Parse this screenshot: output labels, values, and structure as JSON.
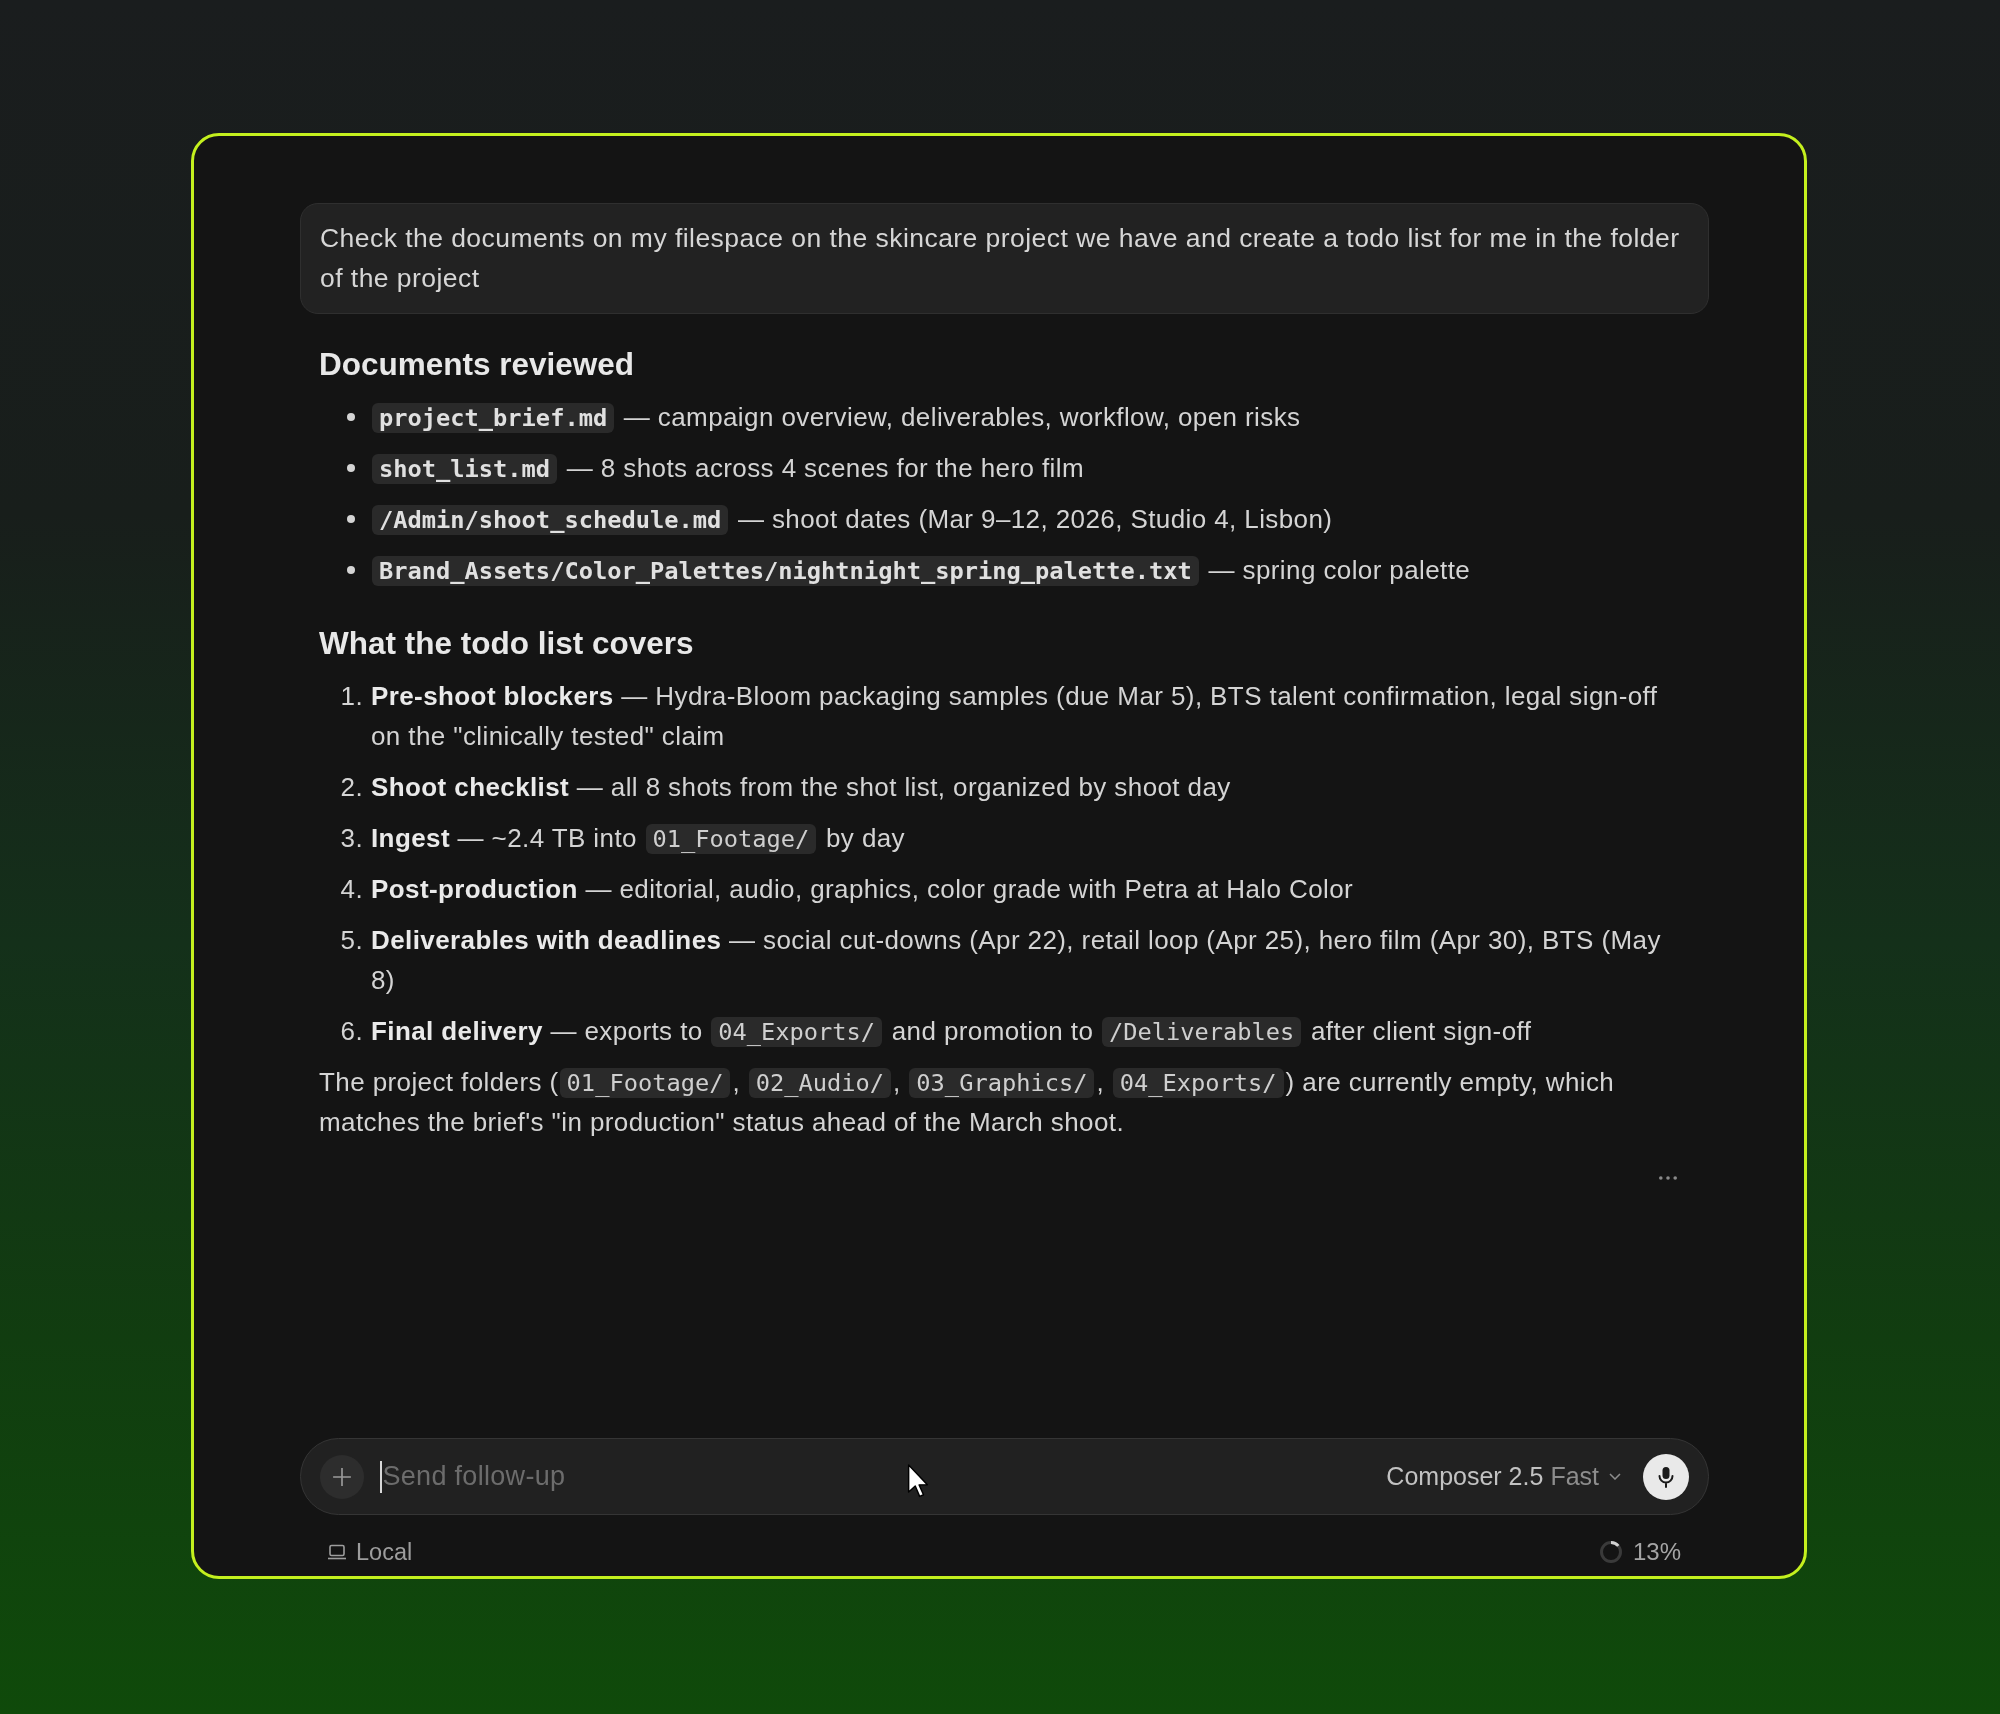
{
  "prompt": {
    "text": "Check the documents on my filespace on the skincare project we have and create a todo list for me in the folder of the project"
  },
  "response": {
    "blocks": [
      {
        "kind": "heading",
        "text": "Documents reviewed"
      },
      {
        "kind": "bullets",
        "items": [
          {
            "parts": [
              {
                "kind": "strong_code",
                "text": "project_brief.md"
              },
              {
                "kind": "text",
                "text": " — campaign overview, deliverables, workflow, open risks"
              }
            ]
          },
          {
            "parts": [
              {
                "kind": "strong_code",
                "text": "shot_list.md"
              },
              {
                "kind": "text",
                "text": " — 8 shots across 4 scenes for the hero film"
              }
            ]
          },
          {
            "parts": [
              {
                "kind": "strong_code",
                "text": "/Admin/shoot_schedule.md"
              },
              {
                "kind": "text",
                "text": " — shoot dates (Mar 9–12, 2026, Studio 4, Lisbon)"
              }
            ]
          },
          {
            "parts": [
              {
                "kind": "strong_code",
                "text": "Brand_Assets/Color_Palettes/nightnight_spring_palette.txt"
              },
              {
                "kind": "text",
                "text": " — spring color palette"
              }
            ]
          }
        ]
      },
      {
        "kind": "heading",
        "text": "What the todo list covers"
      },
      {
        "kind": "numbered",
        "items": [
          {
            "number": "1.",
            "parts": [
              {
                "kind": "text",
                "text": "**Pre-shoot blockers** — Hydra-Bloom packaging samples (due Mar 5), BTS talent confirmation, legal sign-off on the \"clinically tested\" claim"
              }
            ]
          },
          {
            "number": "2.",
            "parts": [
              {
                "kind": "text",
                "text": "**Shoot checklist** — all 8 shots from the shot list, organized by shoot day"
              }
            ]
          },
          {
            "number": "3.",
            "parts": [
              {
                "kind": "text",
                "text": "**Ingest** — ~2.4 TB into "
              },
              {
                "kind": "code",
                "text": "01_Footage/"
              },
              {
                "kind": "text",
                "text": " by day"
              }
            ]
          },
          {
            "number": "4.",
            "parts": [
              {
                "kind": "text",
                "text": "**Post-production** — editorial, audio, graphics, color grade with Petra at Halo Color"
              }
            ]
          },
          {
            "number": "5.",
            "parts": [
              {
                "kind": "text",
                "text": "**Deliverables with deadlines** — social cut-downs (Apr 22), retail loop (Apr 25), hero film (Apr 30), BTS (May 8)"
              }
            ]
          },
          {
            "number": "6.",
            "parts": [
              {
                "kind": "text",
                "text": "**Final delivery** — exports to "
              },
              {
                "kind": "code",
                "text": "04_Exports/"
              },
              {
                "kind": "text",
                "text": " and promotion to "
              },
              {
                "kind": "code",
                "text": "/Deliverables"
              },
              {
                "kind": "text",
                "text": " after client sign-off"
              }
            ]
          }
        ]
      },
      {
        "kind": "paragraph",
        "parts": [
          {
            "kind": "text",
            "text": "The project folders ("
          },
          {
            "kind": "code",
            "text": "01_Footage/"
          },
          {
            "kind": "text",
            "text": ", "
          },
          {
            "kind": "code",
            "text": "02_Audio/"
          },
          {
            "kind": "text",
            "text": ", "
          },
          {
            "kind": "code",
            "text": "03_Graphics/"
          },
          {
            "kind": "text",
            "text": ", "
          },
          {
            "kind": "code",
            "text": "04_Exports/"
          },
          {
            "kind": "text",
            "text": ") are currently empty, which matches the brief's \"in production\" status ahead of the March shoot."
          }
        ]
      }
    ]
  },
  "composer": {
    "placeholder": "Send follow-up",
    "model": "Composer 2.5",
    "mode": "Fast"
  },
  "status_bar": {
    "location": "Local",
    "context_usage": "13%"
  }
}
